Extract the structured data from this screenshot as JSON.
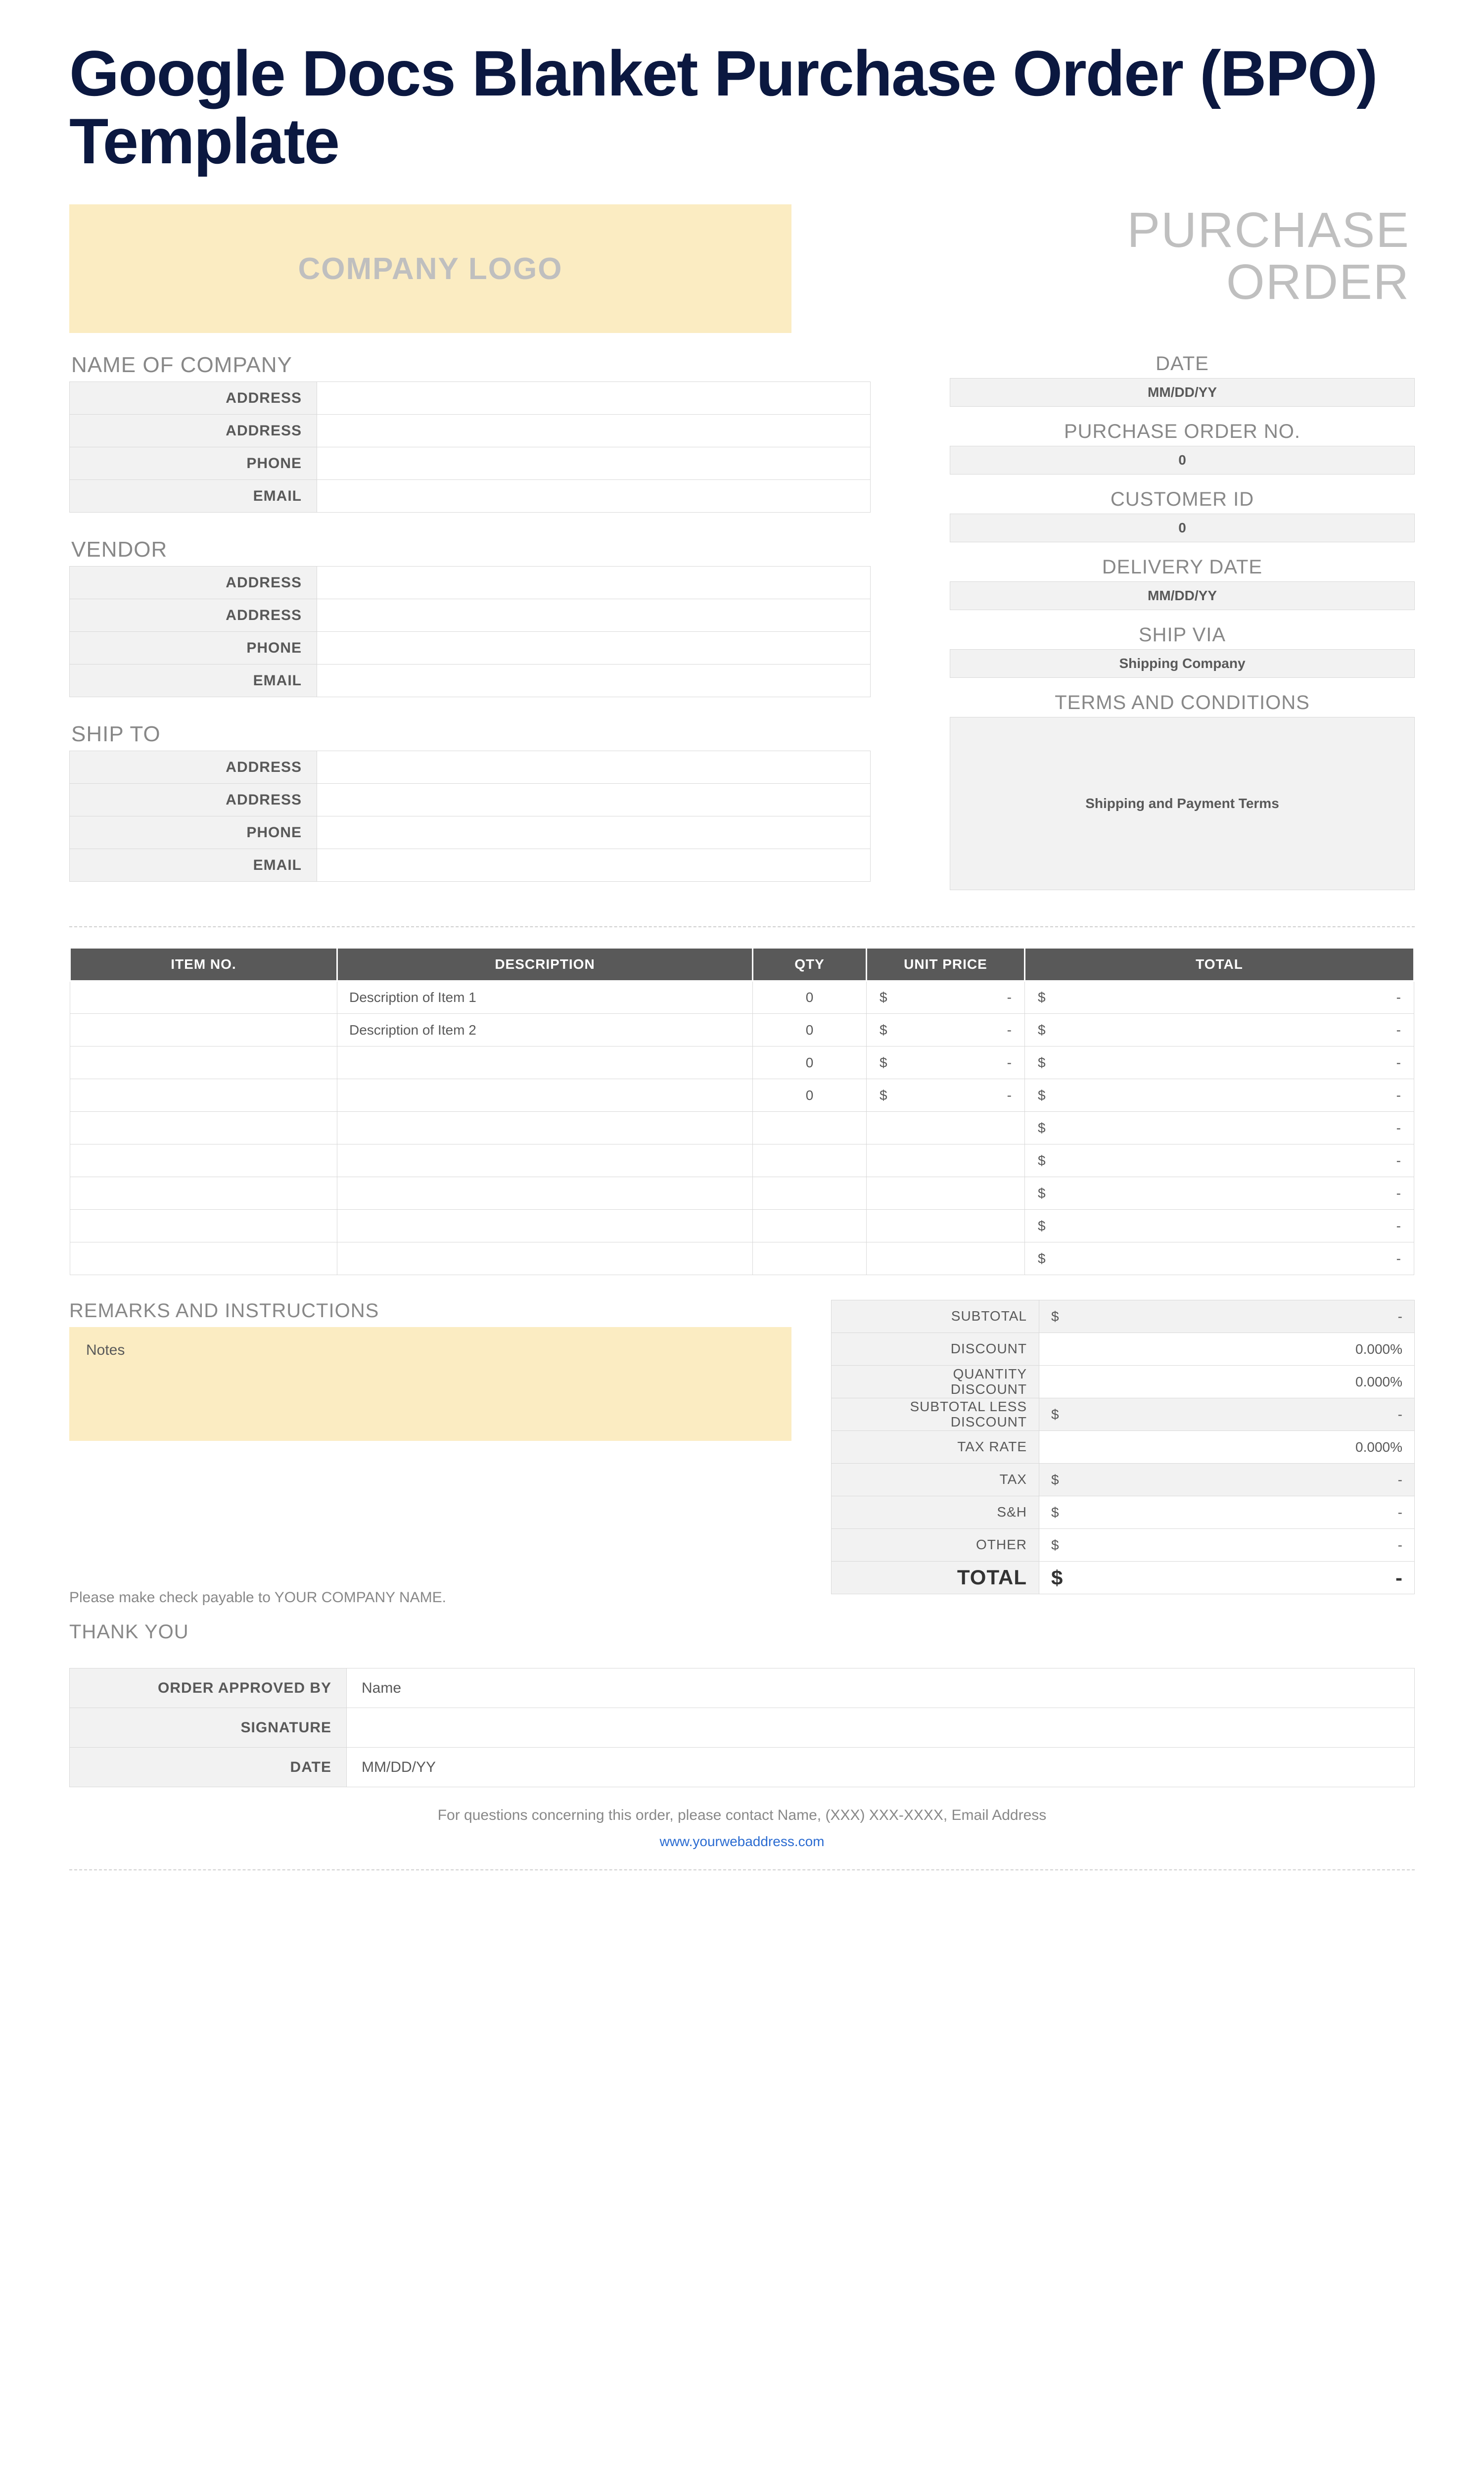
{
  "title": "Google Docs Blanket Purchase Order (BPO) Template",
  "logo_text": "COMPANY LOGO",
  "po_heading_line1": "PURCHASE",
  "po_heading_line2": "ORDER",
  "company": {
    "heading": "NAME OF COMPANY",
    "rows": [
      {
        "label": "ADDRESS",
        "value": ""
      },
      {
        "label": "ADDRESS",
        "value": ""
      },
      {
        "label": "PHONE",
        "value": ""
      },
      {
        "label": "EMAIL",
        "value": ""
      }
    ]
  },
  "vendor": {
    "heading": "VENDOR",
    "rows": [
      {
        "label": "ADDRESS",
        "value": ""
      },
      {
        "label": "ADDRESS",
        "value": ""
      },
      {
        "label": "PHONE",
        "value": ""
      },
      {
        "label": "EMAIL",
        "value": ""
      }
    ]
  },
  "shipto": {
    "heading": "SHIP TO",
    "rows": [
      {
        "label": "ADDRESS",
        "value": ""
      },
      {
        "label": "ADDRESS",
        "value": ""
      },
      {
        "label": "PHONE",
        "value": ""
      },
      {
        "label": "EMAIL",
        "value": ""
      }
    ]
  },
  "meta": {
    "date": {
      "label": "DATE",
      "value": "MM/DD/YY"
    },
    "po_no": {
      "label": "PURCHASE ORDER NO.",
      "value": "0"
    },
    "customer_id": {
      "label": "CUSTOMER ID",
      "value": "0"
    },
    "delivery_date": {
      "label": "DELIVERY DATE",
      "value": "MM/DD/YY"
    },
    "ship_via": {
      "label": "SHIP VIA",
      "value": "Shipping Company"
    },
    "terms": {
      "label": "TERMS AND CONDITIONS",
      "value": "Shipping and Payment Terms"
    }
  },
  "items": {
    "headers": {
      "item_no": "ITEM NO.",
      "description": "DESCRIPTION",
      "qty": "QTY",
      "unit_price": "UNIT PRICE",
      "total": "TOTAL"
    },
    "currency": "$",
    "rows": [
      {
        "item_no": "",
        "description": "Description of Item 1",
        "qty": "0",
        "unit_price": "-",
        "total": "-"
      },
      {
        "item_no": "",
        "description": "Description of Item 2",
        "qty": "0",
        "unit_price": "-",
        "total": "-"
      },
      {
        "item_no": "",
        "description": "",
        "qty": "0",
        "unit_price": "-",
        "total": "-"
      },
      {
        "item_no": "",
        "description": "",
        "qty": "0",
        "unit_price": "-",
        "total": "-"
      },
      {
        "item_no": "",
        "description": "",
        "qty": "",
        "unit_price": "",
        "total": "-"
      },
      {
        "item_no": "",
        "description": "",
        "qty": "",
        "unit_price": "",
        "total": "-"
      },
      {
        "item_no": "",
        "description": "",
        "qty": "",
        "unit_price": "",
        "total": "-"
      },
      {
        "item_no": "",
        "description": "",
        "qty": "",
        "unit_price": "",
        "total": "-"
      },
      {
        "item_no": "",
        "description": "",
        "qty": "",
        "unit_price": "",
        "total": "-"
      }
    ]
  },
  "remarks": {
    "heading": "REMARKS AND INSTRUCTIONS",
    "notes": "Notes"
  },
  "payable_text": "Please make check payable to YOUR COMPANY NAME.",
  "thank_you": "THANK YOU",
  "totals": {
    "currency": "$",
    "rows": [
      {
        "key": "subtotal",
        "label": "SUBTOTAL",
        "value": "-",
        "money": true,
        "shade": true
      },
      {
        "key": "discount",
        "label": "DISCOUNT",
        "value": "0.000%",
        "money": false,
        "shade": false
      },
      {
        "key": "qty_discount",
        "label": "QUANTITY DISCOUNT",
        "value": "0.000%",
        "money": false,
        "shade": false
      },
      {
        "key": "subtotal_less",
        "label": "SUBTOTAL LESS DISCOUNT",
        "value": "-",
        "money": true,
        "shade": true
      },
      {
        "key": "tax_rate",
        "label": "TAX RATE",
        "value": "0.000%",
        "money": false,
        "shade": false
      },
      {
        "key": "tax",
        "label": "TAX",
        "value": "-",
        "money": true,
        "shade": true
      },
      {
        "key": "s_and_h",
        "label": "S&H",
        "value": "-",
        "money": true,
        "shade": false
      },
      {
        "key": "other",
        "label": "OTHER",
        "value": "-",
        "money": true,
        "shade": false
      }
    ],
    "grand": {
      "label": "TOTAL",
      "value": "-"
    }
  },
  "approval": {
    "rows": [
      {
        "label": "ORDER APPROVED BY",
        "value": "Name"
      },
      {
        "label": "SIGNATURE",
        "value": ""
      },
      {
        "label": "DATE",
        "value": "MM/DD/YY"
      }
    ]
  },
  "footer": {
    "contact": "For questions concerning this order, please contact Name, (XXX) XXX-XXXX, Email Address",
    "url": "www.yourwebaddress.com"
  }
}
